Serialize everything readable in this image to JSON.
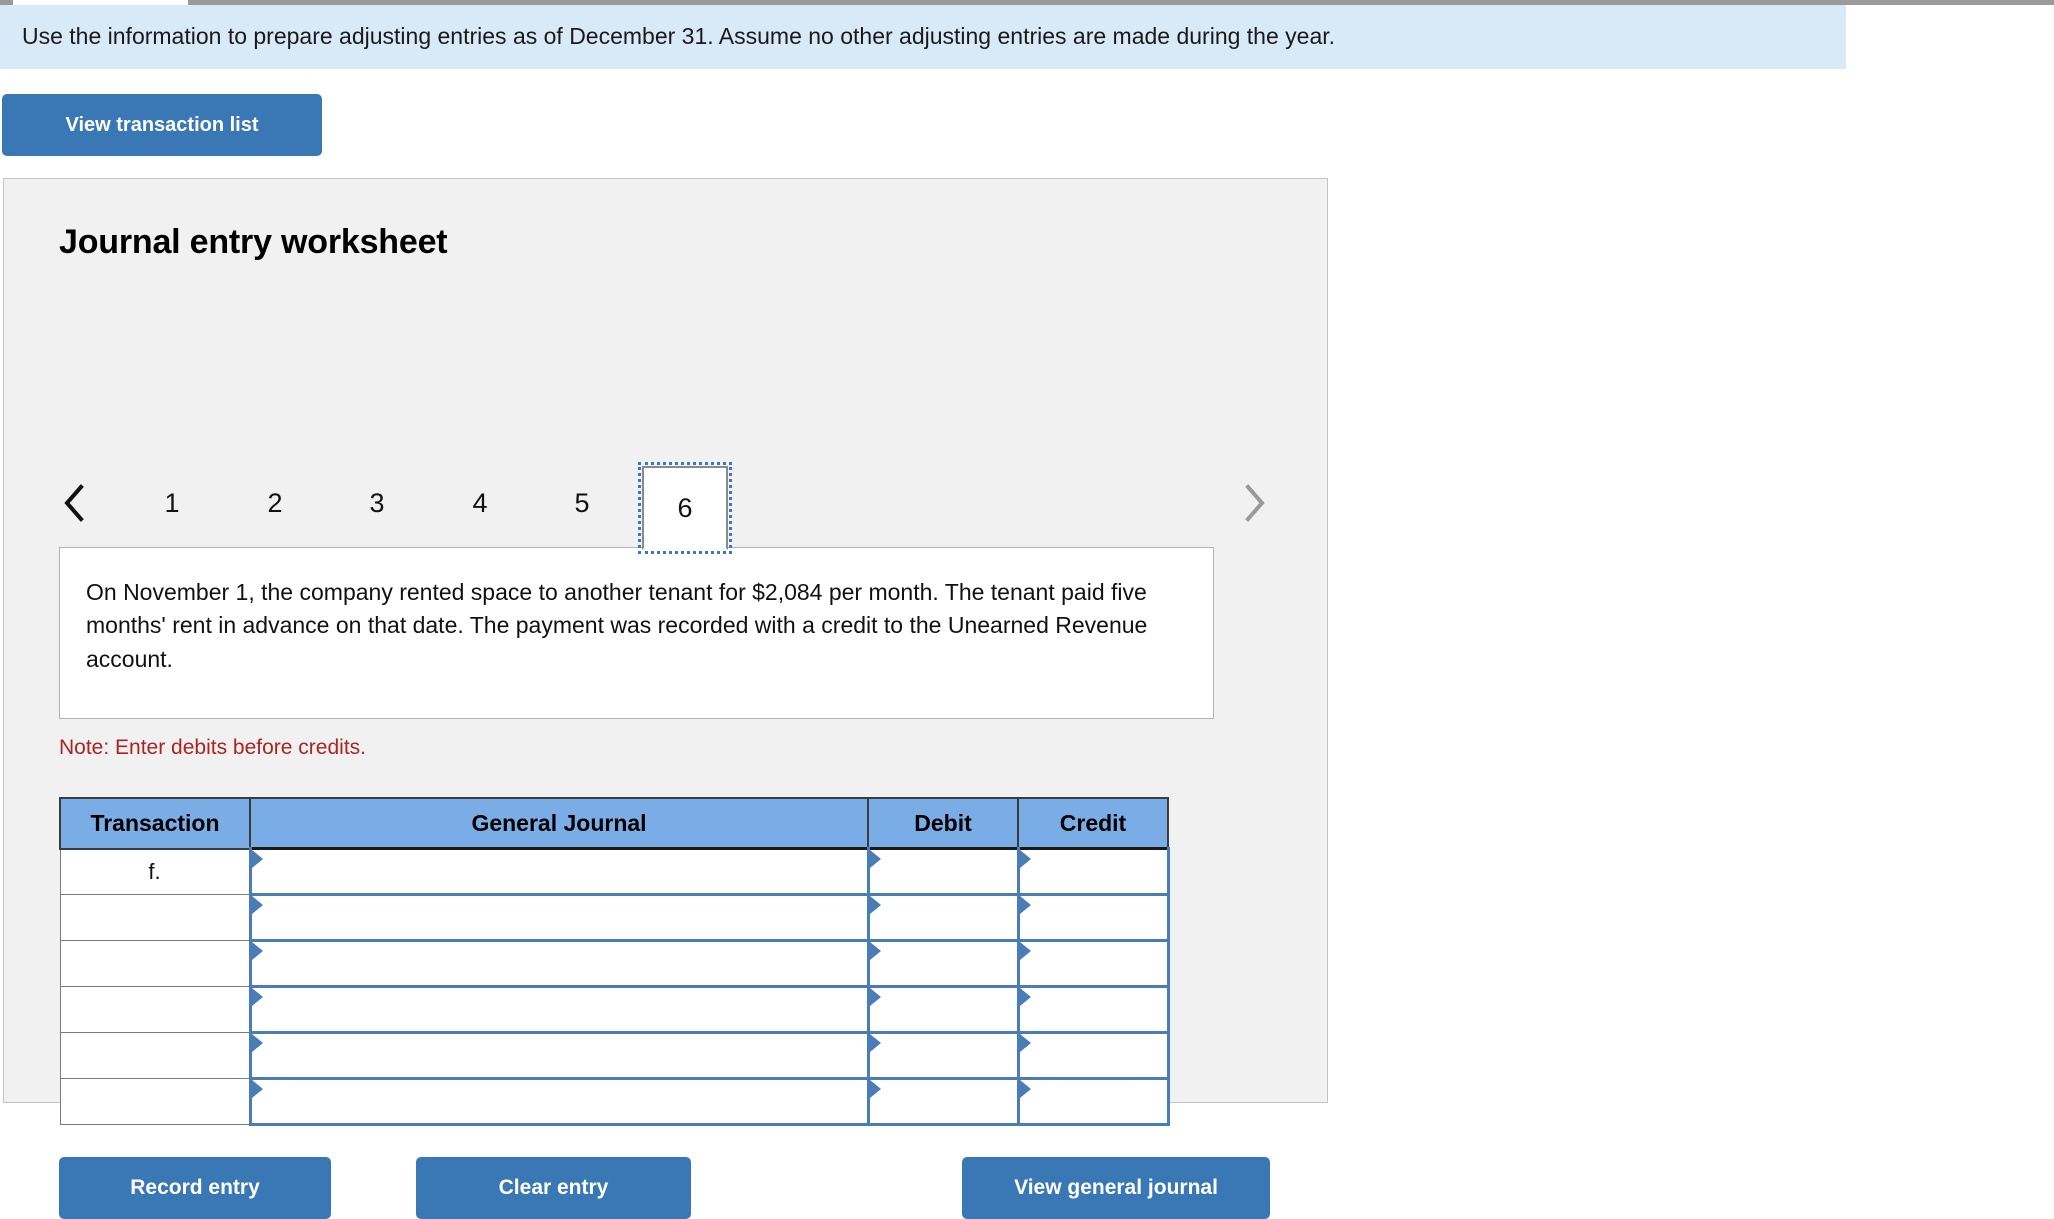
{
  "banner": {
    "instruction": "Use the information to prepare adjusting entries as of December 31. Assume no other adjusting entries are made during the year."
  },
  "toolbar": {
    "view_transaction_list_label": "View transaction list"
  },
  "worksheet": {
    "title": "Journal entry worksheet",
    "nav": {
      "prev_icon": "chevron-left-icon",
      "next_icon": "chevron-right-icon"
    },
    "tabs": [
      {
        "label": "1",
        "selected": false
      },
      {
        "label": "2",
        "selected": false
      },
      {
        "label": "3",
        "selected": false
      },
      {
        "label": "4",
        "selected": false
      },
      {
        "label": "5",
        "selected": false
      },
      {
        "label": "6",
        "selected": true
      }
    ],
    "description": "On November 1, the company rented space to another tenant for $2,084 per month. The tenant paid five months' rent in advance on that date. The payment was recorded with a credit to the Unearned Revenue account.",
    "note": "Note: Enter debits before credits.",
    "table": {
      "headers": {
        "transaction": "Transaction",
        "general_journal": "General Journal",
        "debit": "Debit",
        "credit": "Credit"
      },
      "rows": [
        {
          "transaction": "f.",
          "general_journal": "",
          "debit": "",
          "credit": ""
        },
        {
          "transaction": "",
          "general_journal": "",
          "debit": "",
          "credit": ""
        },
        {
          "transaction": "",
          "general_journal": "",
          "debit": "",
          "credit": ""
        },
        {
          "transaction": "",
          "general_journal": "",
          "debit": "",
          "credit": ""
        },
        {
          "transaction": "",
          "general_journal": "",
          "debit": "",
          "credit": ""
        },
        {
          "transaction": "",
          "general_journal": "",
          "debit": "",
          "credit": ""
        }
      ]
    },
    "actions": {
      "record_entry_label": "Record entry",
      "clear_entry_label": "Clear entry",
      "view_general_journal_label": "View general journal"
    }
  },
  "colors": {
    "banner_bg": "#d8e9f8",
    "button_blue": "#3a78b5",
    "table_header_blue": "#7aade6",
    "input_border_blue": "#4a7cb5",
    "note_red": "#a82622",
    "panel_bg": "#f1f1f1"
  }
}
